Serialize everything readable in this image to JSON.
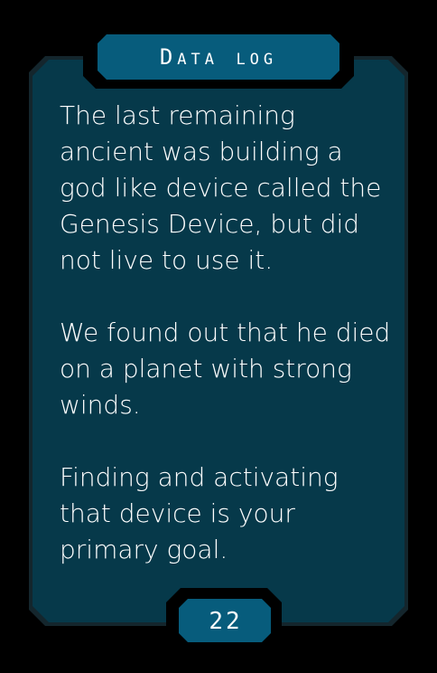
{
  "card": {
    "title": "Data log",
    "paragraphs": [
      "The last remaining ancient was building a god like device called the Genesis Device, but did not live to use it.",
      "We found out that he died on a planet with strong winds.",
      "Finding and activating that device is  your primary goal."
    ],
    "page_number": "22"
  },
  "colors": {
    "background": "#000000",
    "card_fill": "#06394a",
    "card_border": "#14262d",
    "tab_fill": "#075c7c",
    "text": "#ffffff"
  }
}
